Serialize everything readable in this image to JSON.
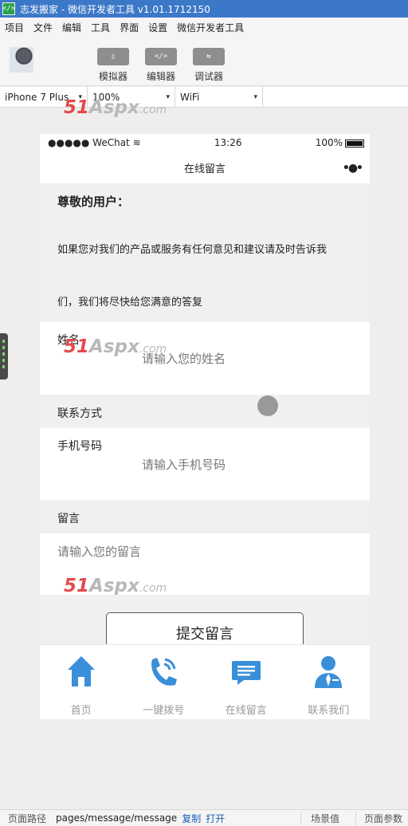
{
  "window": {
    "title": "志发搬家 - 微信开发者工具 v1.01.1712150",
    "app_icon": "</>"
  },
  "menu": [
    "项目",
    "文件",
    "编辑",
    "工具",
    "界面",
    "设置",
    "微信开发者工具"
  ],
  "toolbar": {
    "tools": [
      {
        "label": "模拟器",
        "icon": "phone-icon",
        "glyph": "▯"
      },
      {
        "label": "编辑器",
        "icon": "code-icon",
        "glyph": "</>"
      },
      {
        "label": "调试器",
        "icon": "debug-icon",
        "glyph": "⇆"
      }
    ]
  },
  "selectors": {
    "device": "iPhone 7 Plus",
    "zoom": "100%",
    "network": "WiFi"
  },
  "status_bar": {
    "signal": "●●●●● WeChat",
    "time": "13:26",
    "battery": "100%"
  },
  "nav": {
    "title": "在线留言",
    "menu_dots": "•●•"
  },
  "intro": {
    "greeting": "尊敬的用户：",
    "line1": "如果您对我们的产品或服务有任何意见和建议请及时告诉我",
    "line2": "们，我们将尽快给您满意的答复"
  },
  "form": {
    "name_label": "姓名",
    "name_placeholder": "请输入您的姓名",
    "contact_header": "联系方式",
    "phone_label": "手机号码",
    "phone_placeholder": "请输入手机号码",
    "message_header": "留言",
    "message_placeholder": "请输入您的留言",
    "submit_label": "提交留言"
  },
  "tabbar": [
    {
      "label": "首页",
      "icon": "home-icon"
    },
    {
      "label": "一键拨号",
      "icon": "phone-call-icon"
    },
    {
      "label": "在线留言",
      "icon": "message-icon"
    },
    {
      "label": "联系我们",
      "icon": "contact-icon"
    }
  ],
  "watermark": {
    "num": "51",
    "brand": "Aspx",
    "tld": ".com"
  },
  "footer": {
    "path_label": "页面路径",
    "path": "pages/message/message",
    "copy": "复制",
    "open": "打开",
    "scene": "场景值",
    "params": "页面参数"
  },
  "colors": {
    "accent_blue": "#3a8fd9",
    "titlebar": "#3c78c8",
    "watermark_red": "#e44a4a"
  }
}
